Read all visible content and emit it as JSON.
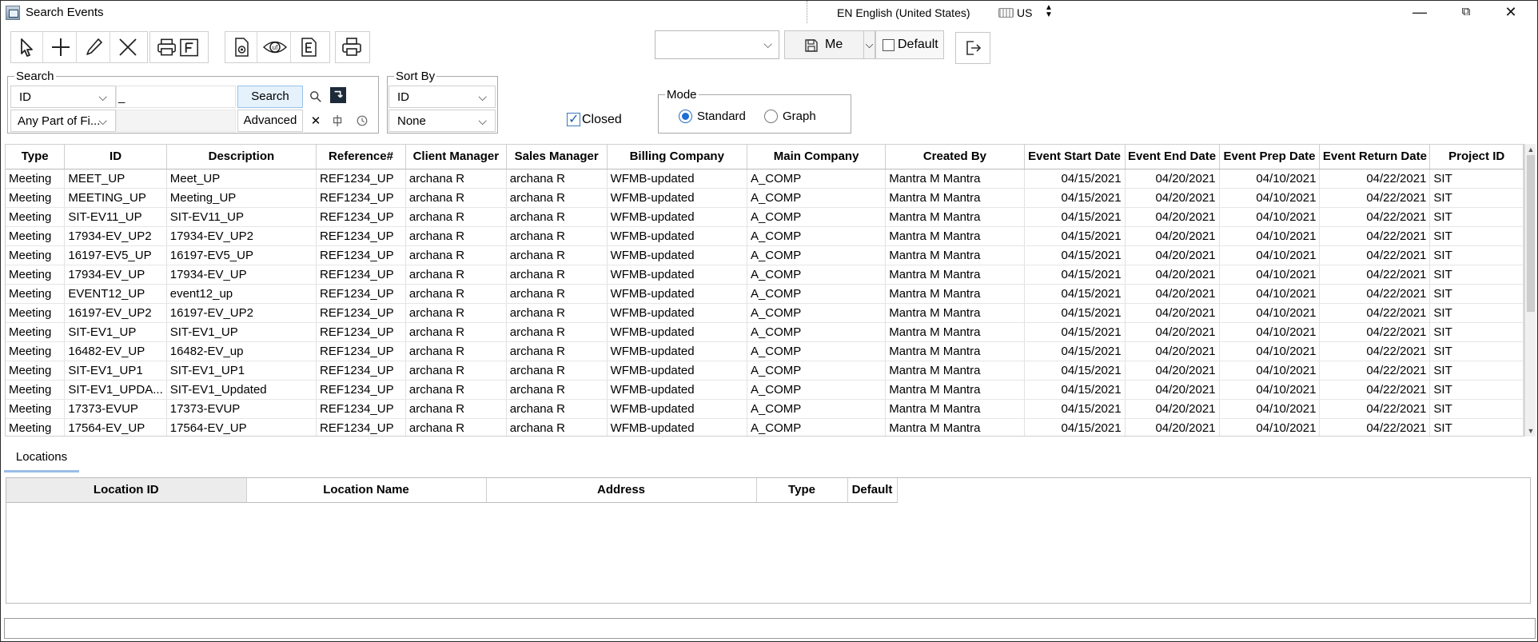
{
  "window": {
    "title": "Search Events"
  },
  "titlebar": {
    "language": "EN English (United States)",
    "keyboard": "US",
    "minimize": "—",
    "restore": "⧉",
    "close": "✕"
  },
  "toolbar": {
    "icons": [
      "pointer-icon",
      "plus-icon",
      "pencil-icon",
      "x-icon",
      "print-f-icon",
      "settings-doc-icon",
      "uf-eye-icon",
      "e-doc-icon",
      "printer-icon"
    ]
  },
  "filter": {
    "combo_value": "",
    "user_label": "Me",
    "default_label": "Default",
    "default_checked": false
  },
  "search": {
    "legend": "Search",
    "field_value": "ID",
    "query": "_",
    "button": "Search",
    "match_value": "Any Part of Fi...",
    "advanced_button": "Advanced"
  },
  "sort": {
    "legend": "Sort By",
    "primary": "ID",
    "secondary": "None"
  },
  "closed": {
    "label": "Closed",
    "checked": true
  },
  "mode": {
    "legend": "Mode",
    "options": [
      "Standard",
      "Graph"
    ],
    "selected": "Standard"
  },
  "events": {
    "columns": [
      "Type",
      "ID",
      "Description",
      "Reference#",
      "Client Manager",
      "Sales Manager",
      "Billing Company",
      "Main Company",
      "Created By",
      "Event Start Date",
      "Event End Date",
      "Event Prep Date",
      "Event Return Date",
      "Project ID"
    ],
    "rows": [
      [
        "Meeting",
        "MEET_UP",
        "Meet_UP",
        "REF1234_UP",
        "archana  R",
        "archana  R",
        "WFMB-updated",
        "A_COMP",
        "Mantra M Mantra",
        "04/15/2021",
        "04/20/2021",
        "04/10/2021",
        "04/22/2021",
        "SIT"
      ],
      [
        "Meeting",
        "MEETING_UP",
        "Meeting_UP",
        "REF1234_UP",
        "archana  R",
        "archana  R",
        "WFMB-updated",
        "A_COMP",
        "Mantra M Mantra",
        "04/15/2021",
        "04/20/2021",
        "04/10/2021",
        "04/22/2021",
        "SIT"
      ],
      [
        "Meeting",
        "SIT-EV11_UP",
        "SIT-EV11_UP",
        "REF1234_UP",
        "archana  R",
        "archana  R",
        "WFMB-updated",
        "A_COMP",
        "Mantra M Mantra",
        "04/15/2021",
        "04/20/2021",
        "04/10/2021",
        "04/22/2021",
        "SIT"
      ],
      [
        "Meeting",
        "17934-EV_UP2",
        "17934-EV_UP2",
        "REF1234_UP",
        "archana  R",
        "archana  R",
        "WFMB-updated",
        "A_COMP",
        "Mantra M Mantra",
        "04/15/2021",
        "04/20/2021",
        "04/10/2021",
        "04/22/2021",
        "SIT"
      ],
      [
        "Meeting",
        "16197-EV5_UP",
        "16197-EV5_UP",
        "REF1234_UP",
        "archana  R",
        "archana  R",
        "WFMB-updated",
        "A_COMP",
        "Mantra M Mantra",
        "04/15/2021",
        "04/20/2021",
        "04/10/2021",
        "04/22/2021",
        "SIT"
      ],
      [
        "Meeting",
        "17934-EV_UP",
        "17934-EV_UP",
        "REF1234_UP",
        "archana  R",
        "archana  R",
        "WFMB-updated",
        "A_COMP",
        "Mantra M Mantra",
        "04/15/2021",
        "04/20/2021",
        "04/10/2021",
        "04/22/2021",
        "SIT"
      ],
      [
        "Meeting",
        "EVENT12_UP",
        "event12_up",
        "REF1234_UP",
        "archana  R",
        "archana  R",
        "WFMB-updated",
        "A_COMP",
        "Mantra M Mantra",
        "04/15/2021",
        "04/20/2021",
        "04/10/2021",
        "04/22/2021",
        "SIT"
      ],
      [
        "Meeting",
        "16197-EV_UP2",
        "16197-EV_UP2",
        "REF1234_UP",
        "archana  R",
        "archana  R",
        "WFMB-updated",
        "A_COMP",
        "Mantra M Mantra",
        "04/15/2021",
        "04/20/2021",
        "04/10/2021",
        "04/22/2021",
        "SIT"
      ],
      [
        "Meeting",
        "SIT-EV1_UP",
        "SIT-EV1_UP",
        "REF1234_UP",
        "archana  R",
        "archana  R",
        "WFMB-updated",
        "A_COMP",
        "Mantra M Mantra",
        "04/15/2021",
        "04/20/2021",
        "04/10/2021",
        "04/22/2021",
        "SIT"
      ],
      [
        "Meeting",
        "16482-EV_UP",
        "16482-EV_up",
        "REF1234_UP",
        "archana  R",
        "archana  R",
        "WFMB-updated",
        "A_COMP",
        "Mantra M Mantra",
        "04/15/2021",
        "04/20/2021",
        "04/10/2021",
        "04/22/2021",
        "SIT"
      ],
      [
        "Meeting",
        "SIT-EV1_UP1",
        "SIT-EV1_UP1",
        "REF1234_UP",
        "archana  R",
        "archana  R",
        "WFMB-updated",
        "A_COMP",
        "Mantra M Mantra",
        "04/15/2021",
        "04/20/2021",
        "04/10/2021",
        "04/22/2021",
        "SIT"
      ],
      [
        "Meeting",
        "SIT-EV1_UPDA...",
        "SIT-EV1_Updated",
        "REF1234_UP",
        "archana  R",
        "archana  R",
        "WFMB-updated",
        "A_COMP",
        "Mantra M Mantra",
        "04/15/2021",
        "04/20/2021",
        "04/10/2021",
        "04/22/2021",
        "SIT"
      ],
      [
        "Meeting",
        "17373-EVUP",
        "17373-EVUP",
        "REF1234_UP",
        "archana  R",
        "archana  R",
        "WFMB-updated",
        "A_COMP",
        "Mantra M Mantra",
        "04/15/2021",
        "04/20/2021",
        "04/10/2021",
        "04/22/2021",
        "SIT"
      ],
      [
        "Meeting",
        "17564-EV_UP",
        "17564-EV_UP",
        "REF1234_UP",
        "archana  R",
        "archana  R",
        "WFMB-updated",
        "A_COMP",
        "Mantra M Mantra",
        "04/15/2021",
        "04/20/2021",
        "04/10/2021",
        "04/22/2021",
        "SIT"
      ]
    ]
  },
  "locations": {
    "tab_label": "Locations",
    "columns": [
      "Location ID",
      "Location Name",
      "Address",
      "Type",
      "Default"
    ]
  },
  "status": {
    "text": ""
  }
}
